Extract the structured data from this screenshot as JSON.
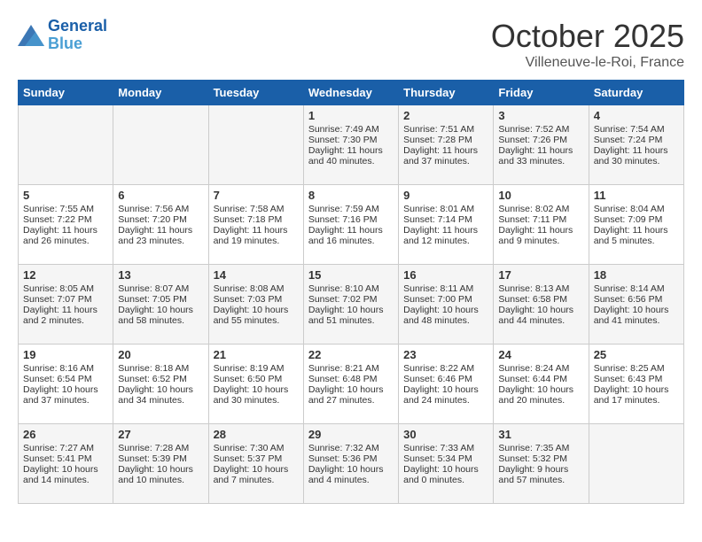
{
  "header": {
    "logo_line1": "General",
    "logo_line2": "Blue",
    "month": "October 2025",
    "location": "Villeneuve-le-Roi, France"
  },
  "days_of_week": [
    "Sunday",
    "Monday",
    "Tuesday",
    "Wednesday",
    "Thursday",
    "Friday",
    "Saturday"
  ],
  "weeks": [
    [
      {
        "day": "",
        "info": ""
      },
      {
        "day": "",
        "info": ""
      },
      {
        "day": "",
        "info": ""
      },
      {
        "day": "1",
        "info": "Sunrise: 7:49 AM\nSunset: 7:30 PM\nDaylight: 11 hours and 40 minutes."
      },
      {
        "day": "2",
        "info": "Sunrise: 7:51 AM\nSunset: 7:28 PM\nDaylight: 11 hours and 37 minutes."
      },
      {
        "day": "3",
        "info": "Sunrise: 7:52 AM\nSunset: 7:26 PM\nDaylight: 11 hours and 33 minutes."
      },
      {
        "day": "4",
        "info": "Sunrise: 7:54 AM\nSunset: 7:24 PM\nDaylight: 11 hours and 30 minutes."
      }
    ],
    [
      {
        "day": "5",
        "info": "Sunrise: 7:55 AM\nSunset: 7:22 PM\nDaylight: 11 hours and 26 minutes."
      },
      {
        "day": "6",
        "info": "Sunrise: 7:56 AM\nSunset: 7:20 PM\nDaylight: 11 hours and 23 minutes."
      },
      {
        "day": "7",
        "info": "Sunrise: 7:58 AM\nSunset: 7:18 PM\nDaylight: 11 hours and 19 minutes."
      },
      {
        "day": "8",
        "info": "Sunrise: 7:59 AM\nSunset: 7:16 PM\nDaylight: 11 hours and 16 minutes."
      },
      {
        "day": "9",
        "info": "Sunrise: 8:01 AM\nSunset: 7:14 PM\nDaylight: 11 hours and 12 minutes."
      },
      {
        "day": "10",
        "info": "Sunrise: 8:02 AM\nSunset: 7:11 PM\nDaylight: 11 hours and 9 minutes."
      },
      {
        "day": "11",
        "info": "Sunrise: 8:04 AM\nSunset: 7:09 PM\nDaylight: 11 hours and 5 minutes."
      }
    ],
    [
      {
        "day": "12",
        "info": "Sunrise: 8:05 AM\nSunset: 7:07 PM\nDaylight: 11 hours and 2 minutes."
      },
      {
        "day": "13",
        "info": "Sunrise: 8:07 AM\nSunset: 7:05 PM\nDaylight: 10 hours and 58 minutes."
      },
      {
        "day": "14",
        "info": "Sunrise: 8:08 AM\nSunset: 7:03 PM\nDaylight: 10 hours and 55 minutes."
      },
      {
        "day": "15",
        "info": "Sunrise: 8:10 AM\nSunset: 7:02 PM\nDaylight: 10 hours and 51 minutes."
      },
      {
        "day": "16",
        "info": "Sunrise: 8:11 AM\nSunset: 7:00 PM\nDaylight: 10 hours and 48 minutes."
      },
      {
        "day": "17",
        "info": "Sunrise: 8:13 AM\nSunset: 6:58 PM\nDaylight: 10 hours and 44 minutes."
      },
      {
        "day": "18",
        "info": "Sunrise: 8:14 AM\nSunset: 6:56 PM\nDaylight: 10 hours and 41 minutes."
      }
    ],
    [
      {
        "day": "19",
        "info": "Sunrise: 8:16 AM\nSunset: 6:54 PM\nDaylight: 10 hours and 37 minutes."
      },
      {
        "day": "20",
        "info": "Sunrise: 8:18 AM\nSunset: 6:52 PM\nDaylight: 10 hours and 34 minutes."
      },
      {
        "day": "21",
        "info": "Sunrise: 8:19 AM\nSunset: 6:50 PM\nDaylight: 10 hours and 30 minutes."
      },
      {
        "day": "22",
        "info": "Sunrise: 8:21 AM\nSunset: 6:48 PM\nDaylight: 10 hours and 27 minutes."
      },
      {
        "day": "23",
        "info": "Sunrise: 8:22 AM\nSunset: 6:46 PM\nDaylight: 10 hours and 24 minutes."
      },
      {
        "day": "24",
        "info": "Sunrise: 8:24 AM\nSunset: 6:44 PM\nDaylight: 10 hours and 20 minutes."
      },
      {
        "day": "25",
        "info": "Sunrise: 8:25 AM\nSunset: 6:43 PM\nDaylight: 10 hours and 17 minutes."
      }
    ],
    [
      {
        "day": "26",
        "info": "Sunrise: 7:27 AM\nSunset: 5:41 PM\nDaylight: 10 hours and 14 minutes."
      },
      {
        "day": "27",
        "info": "Sunrise: 7:28 AM\nSunset: 5:39 PM\nDaylight: 10 hours and 10 minutes."
      },
      {
        "day": "28",
        "info": "Sunrise: 7:30 AM\nSunset: 5:37 PM\nDaylight: 10 hours and 7 minutes."
      },
      {
        "day": "29",
        "info": "Sunrise: 7:32 AM\nSunset: 5:36 PM\nDaylight: 10 hours and 4 minutes."
      },
      {
        "day": "30",
        "info": "Sunrise: 7:33 AM\nSunset: 5:34 PM\nDaylight: 10 hours and 0 minutes."
      },
      {
        "day": "31",
        "info": "Sunrise: 7:35 AM\nSunset: 5:32 PM\nDaylight: 9 hours and 57 minutes."
      },
      {
        "day": "",
        "info": ""
      }
    ]
  ]
}
